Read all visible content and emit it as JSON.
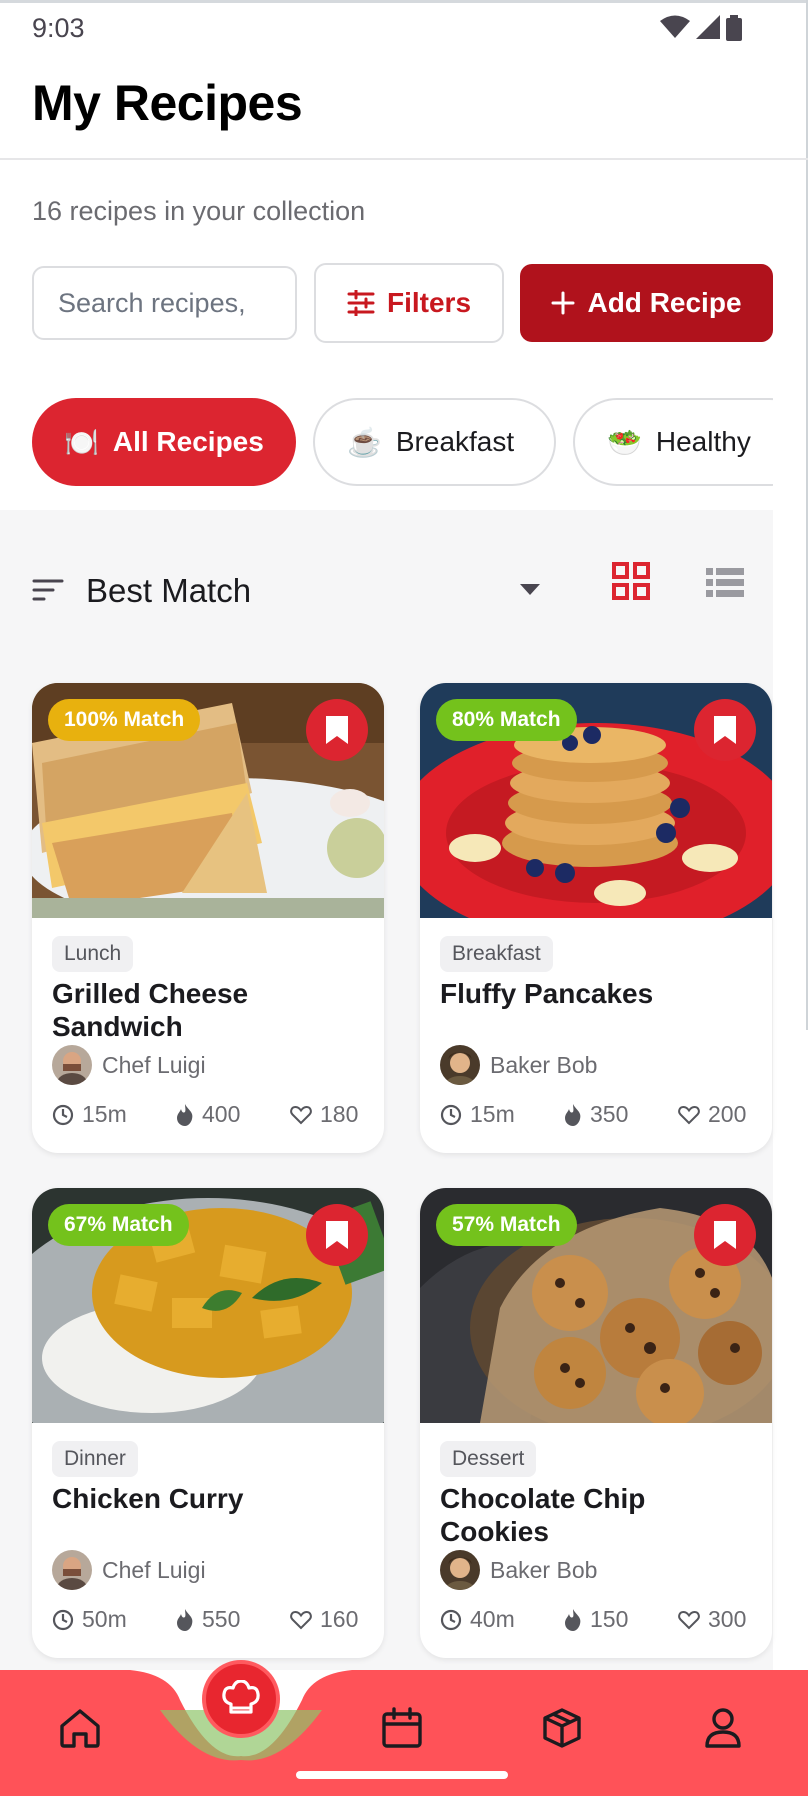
{
  "status_bar": {
    "time": "9:03",
    "icons": [
      "wifi-icon",
      "signal-icon",
      "battery-icon"
    ]
  },
  "header": {
    "title": "My Recipes"
  },
  "subtitle": "16 recipes in your collection",
  "toolbar": {
    "search_placeholder": "Search recipes, ",
    "filters_label": "Filters",
    "add_label": "Add Recipe"
  },
  "categories": [
    {
      "emoji": "🍽️",
      "label": "All Recipes",
      "active": true
    },
    {
      "emoji": "☕",
      "label": "Breakfast",
      "active": false
    },
    {
      "emoji": "🥗",
      "label": "Healthy",
      "active": false
    }
  ],
  "sort": {
    "label": "Best Match",
    "view": "grid"
  },
  "recipes": [
    {
      "match": "100% Match",
      "match_color": "#e8b10e",
      "category": "Lunch",
      "title": "Grilled Cheese Sandwich",
      "author": "Chef Luigi",
      "time": "15m",
      "calories": "400",
      "likes": "180",
      "image": "grilled-cheese"
    },
    {
      "match": "80% Match",
      "match_color": "#74c21c",
      "category": "Breakfast",
      "title": "Fluffy Pancakes",
      "author": "Baker Bob",
      "time": "15m",
      "calories": "350",
      "likes": "200",
      "image": "pancakes"
    },
    {
      "match": "67% Match",
      "match_color": "#74c21c",
      "category": "Dinner",
      "title": "Chicken Curry",
      "author": "Chef Luigi",
      "time": "50m",
      "calories": "550",
      "likes": "160",
      "image": "curry"
    },
    {
      "match": "57% Match",
      "match_color": "#74c21c",
      "category": "Dessert",
      "title": "Chocolate Chip Cookies",
      "author": "Baker Bob",
      "time": "40m",
      "calories": "150",
      "likes": "300",
      "image": "cookies"
    }
  ],
  "bottom_nav": {
    "items": [
      "home-icon",
      "chef-hat-icon",
      "calendar-icon",
      "box-icon",
      "profile-icon"
    ],
    "accent": "#ff5258"
  },
  "colors": {
    "primary": "#dc2530",
    "primary_dark": "#b0121c"
  }
}
